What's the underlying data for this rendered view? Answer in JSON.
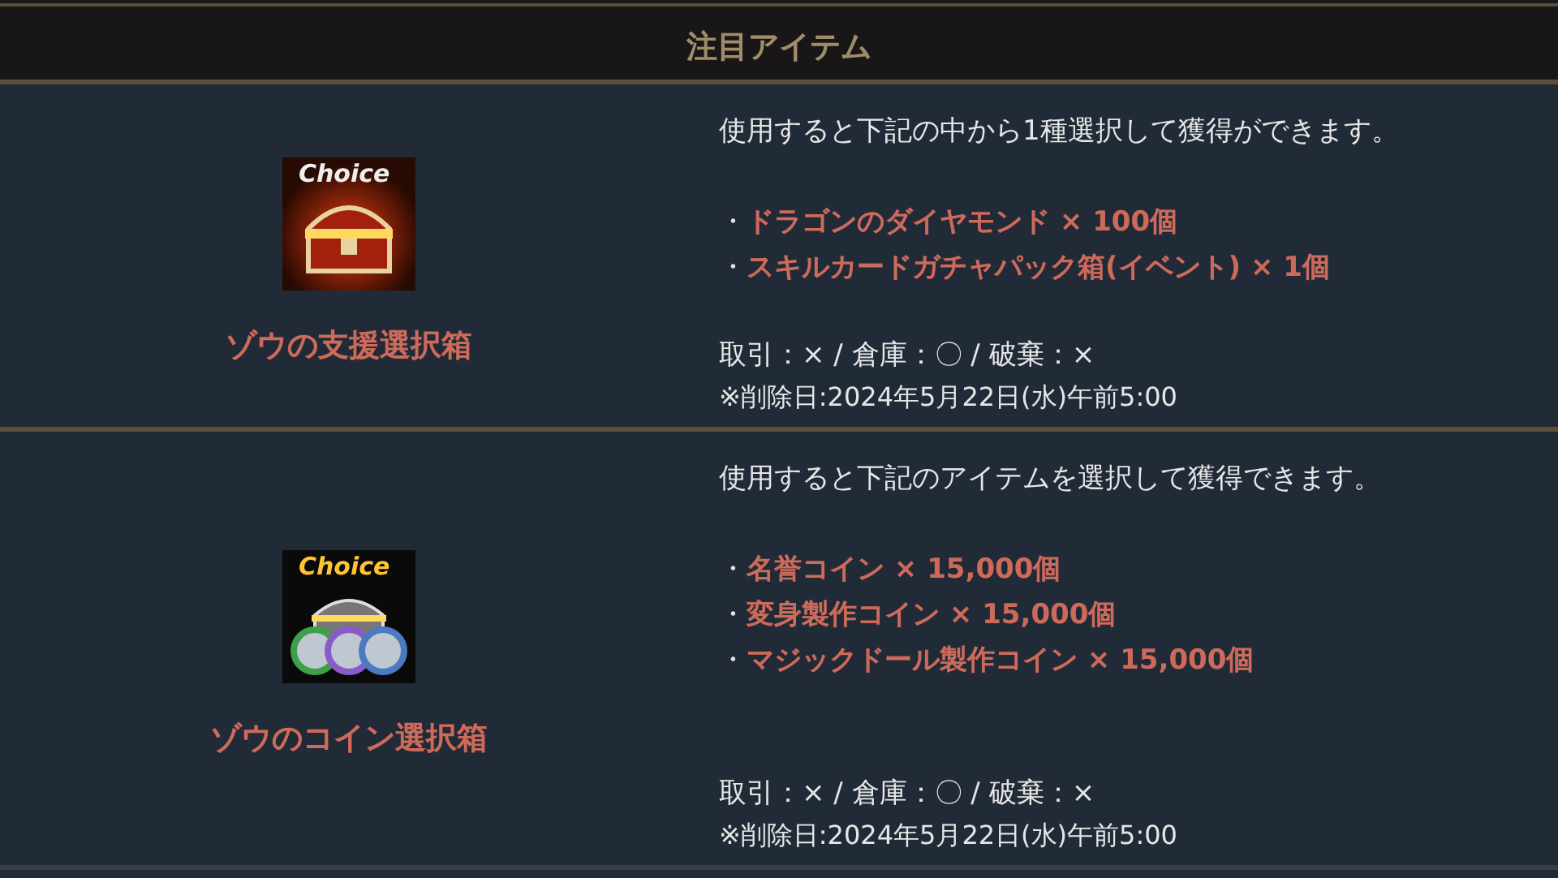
{
  "header": {
    "title": "注目アイテム"
  },
  "items": [
    {
      "kind": "chest",
      "icon_label": "Choice",
      "name": "ゾウの支援選択箱",
      "description": "使用すると下記の中から1種選択して獲得ができます。",
      "bullet": "・",
      "rewards": [
        "ドラゴンのダイヤモンド × 100個",
        "スキルカードガチャパック箱(イベント) × 1個"
      ],
      "properties": "取引：× / 倉庫：〇 / 破棄：×",
      "deletion_date": "※削除日:2024年5月22日(水)午前5:00"
    },
    {
      "kind": "coins",
      "icon_label": "Choice",
      "name": "ゾウのコイン選択箱",
      "description": "使用すると下記のアイテムを選択して獲得できます。",
      "bullet": "・",
      "rewards": [
        "名誉コイン × 15,000個",
        "変身製作コイン × 15,000個",
        "マジックドール製作コイン × 15,000個"
      ],
      "properties": "取引：× / 倉庫：〇 / 破棄：×",
      "deletion_date": "※削除日:2024年5月22日(水)午前5:00"
    }
  ]
}
